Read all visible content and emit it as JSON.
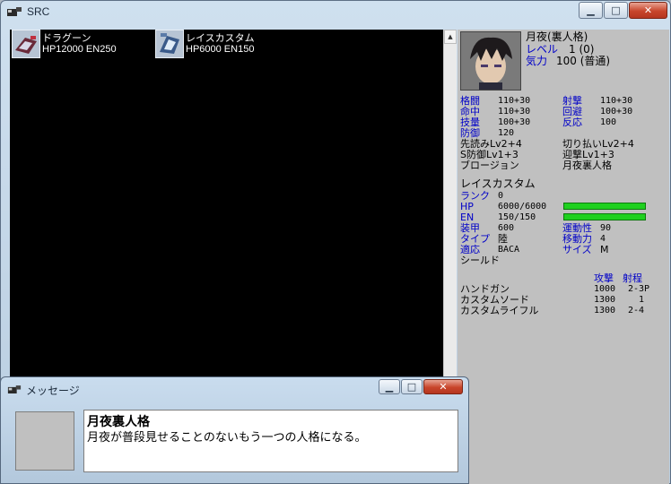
{
  "window": {
    "title": "SRC",
    "minimize": "▁",
    "maximize": "□",
    "close": "✕"
  },
  "map": {
    "units": [
      {
        "name": "ドラグーン",
        "stats": "HP12000 EN250",
        "icon": "mecha-dragoon-icon"
      },
      {
        "name": "レイスカスタム",
        "stats": "HP6000 EN150",
        "icon": "mecha-wraith-icon"
      }
    ],
    "scroll_up": "▲"
  },
  "pilot": {
    "name": "月夜(裏人格)",
    "level_label": "レベル",
    "level_value": "1 (0)",
    "morale_label": "気力",
    "morale_value": "100 (普通)",
    "stats": [
      {
        "label": "格闘",
        "value": "110+30"
      },
      {
        "label": "射撃",
        "value": "110+30"
      },
      {
        "label": "命中",
        "value": "110+30"
      },
      {
        "label": "回避",
        "value": "100+30"
      },
      {
        "label": "技量",
        "value": "100+30"
      },
      {
        "label": "反応",
        "value": "100"
      },
      {
        "label": "防御",
        "value": "120"
      }
    ],
    "skills": [
      "先読みLv2+4",
      "切り払いLv2+4",
      "S防御Lv1+3",
      "迎撃Lv1+3",
      "ブロージョン",
      "月夜裏人格"
    ]
  },
  "unit": {
    "name": "レイスカスタム",
    "rank_label": "ランク",
    "rank_value": "0",
    "hp_label": "HP",
    "hp_value": "6000/6000",
    "hp_fill": 1.0,
    "en_label": "EN",
    "en_value": "150/150",
    "en_fill": 1.0,
    "armor_label": "装甲",
    "armor_value": "600",
    "mobility_label": "運動性",
    "mobility_value": "90",
    "type_label": "タイプ",
    "type_value": "陸",
    "move_label": "移動力",
    "move_value": "4",
    "adapt_label": "適応",
    "adapt_value": "BACA",
    "size_label": "サイズ",
    "size_value": "M",
    "ability": "シールド",
    "weapons_header": {
      "attack": "攻撃",
      "range": "射程"
    },
    "weapons": [
      {
        "name": "ハンドガン",
        "attack": "1000",
        "range": "2-3P"
      },
      {
        "name": "カスタムソード",
        "attack": "1300",
        "range": "1"
      },
      {
        "name": "カスタムライフル",
        "attack": "1300",
        "range": "2-4"
      }
    ],
    "bar_color": "#1fd01f"
  },
  "dialog": {
    "title": "メッセージ",
    "speaker": "月夜裏人格",
    "message": "月夜が普段見せることのないもう一つの人格になる。"
  }
}
